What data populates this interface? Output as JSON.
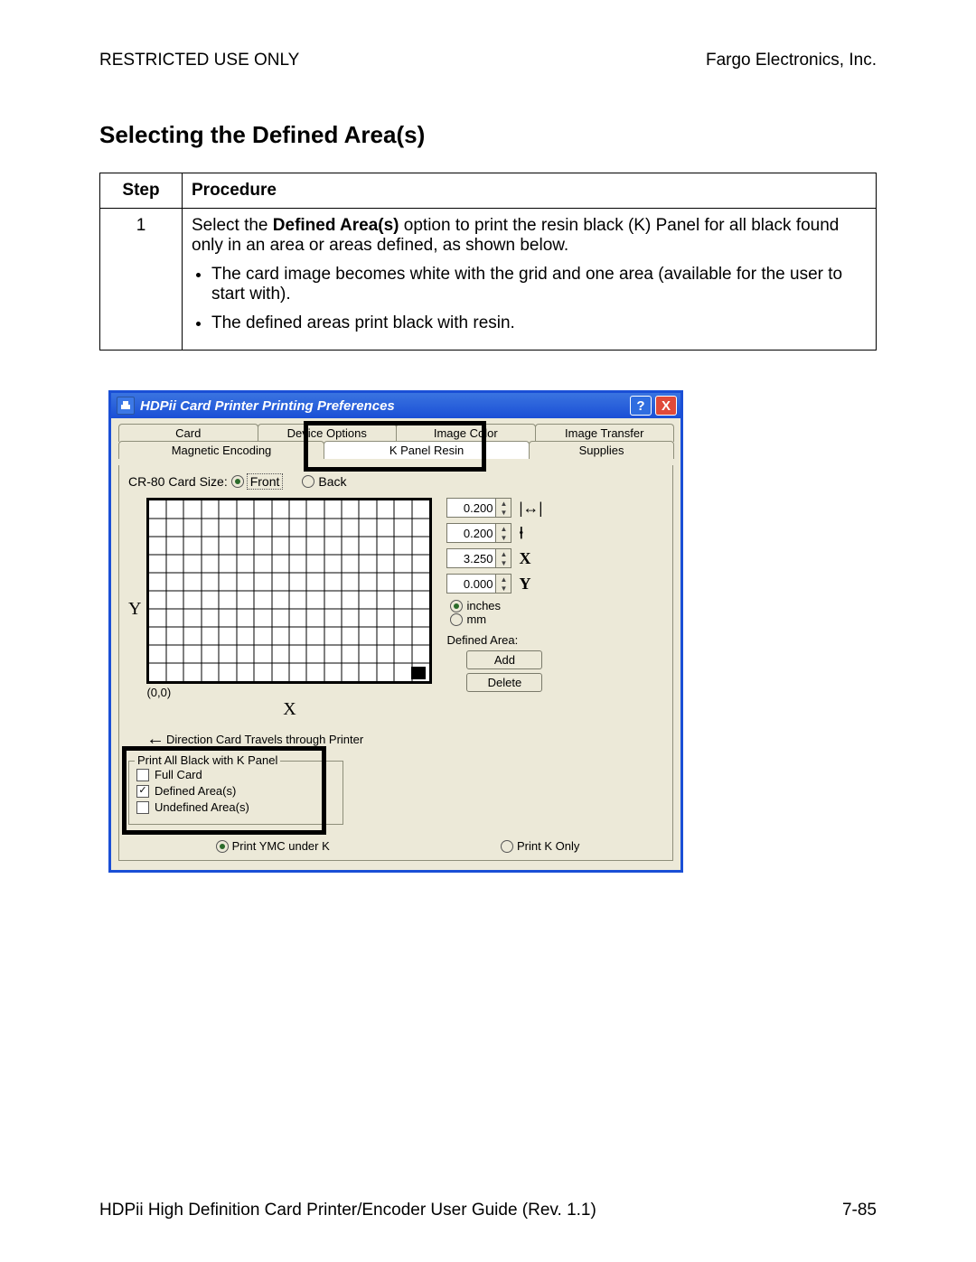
{
  "header": {
    "left": "RESTRICTED USE ONLY",
    "right": "Fargo Electronics, Inc."
  },
  "title": "Selecting the Defined Area(s)",
  "table": {
    "head": {
      "step": "Step",
      "proc": "Procedure"
    },
    "row": {
      "num": "1",
      "p1_a": "Select the ",
      "p1_bold": "Defined Area(s)",
      "p1_b": " option to print the resin black (K) Panel for all black found only in an area or areas defined, as shown below.",
      "b1": "The card image becomes white with the grid and one area (available for the user to start with).",
      "b2": "The defined areas print black with resin."
    }
  },
  "dialog": {
    "title": "HDPii Card Printer Printing Preferences",
    "help": "?",
    "close": "X",
    "tabs_row1": {
      "a": "Card",
      "b": "Device Options",
      "c": "Image Color",
      "d": "Image Transfer"
    },
    "tabs_row2": {
      "a": "Magnetic Encoding",
      "b": "K Panel Resin",
      "c": "Supplies"
    },
    "cardsize_label": "CR-80 Card Size:",
    "front": "Front",
    "back": "Back",
    "origin": "(0,0)",
    "x": "X",
    "y": "Y",
    "spin": {
      "w": "0.200",
      "h": "0.200",
      "x": "3.250",
      "y": "0.000"
    },
    "sym": {
      "w": "⇤⇥",
      "h": "↕",
      "x": "X",
      "y": "Y"
    },
    "units": {
      "in": "inches",
      "mm": "mm"
    },
    "defined_area_label": "Defined Area:",
    "add": "Add",
    "del": "Delete",
    "direction": "Direction Card Travels through Printer",
    "group": {
      "legend": "Print All Black with K Panel",
      "full": "Full Card",
      "def": "Defined Area(s)",
      "undef": "Undefined Area(s)"
    },
    "print": {
      "ymc": "Print YMC under K",
      "konly": "Print K Only"
    }
  },
  "footer": {
    "left": "HDPii High Definition Card Printer/Encoder User Guide (Rev. 1.1)",
    "right": "7-85"
  }
}
